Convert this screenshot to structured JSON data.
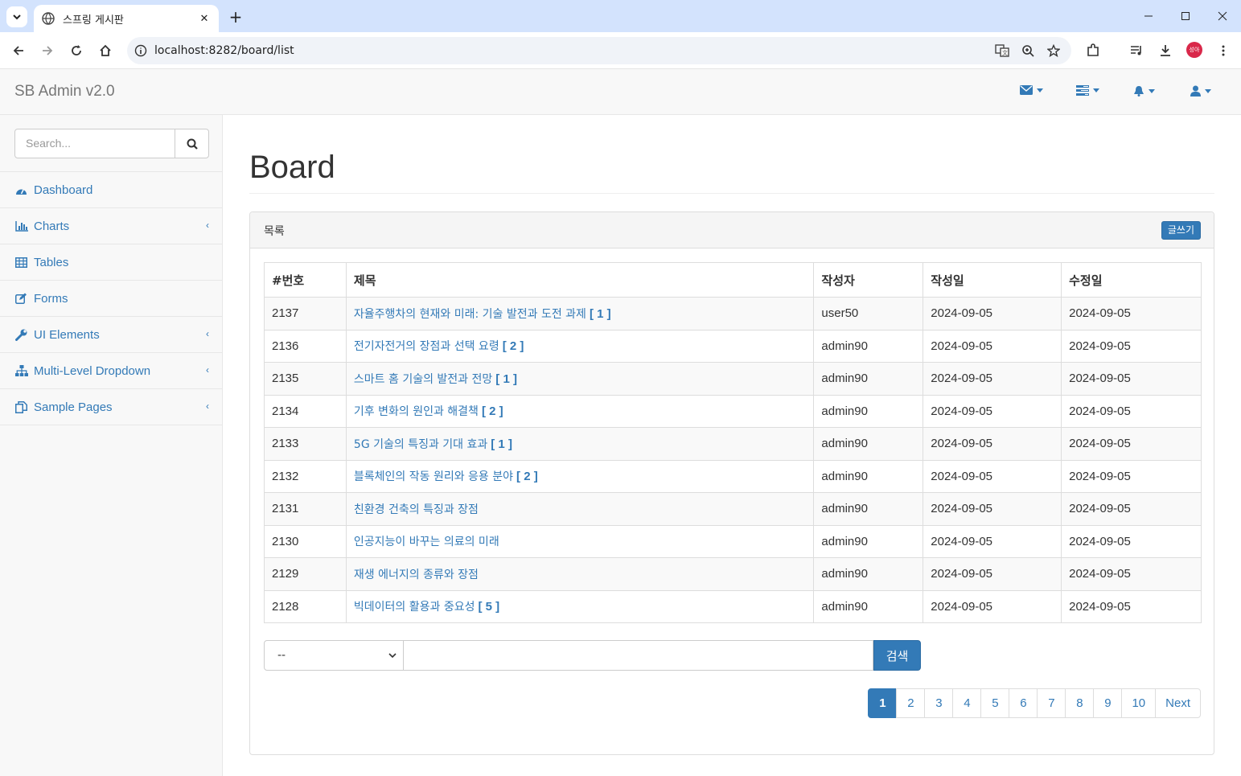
{
  "browser": {
    "tab_title": "스프링 게시판",
    "url": "localhost:8282/board/list",
    "profile_label": "성아"
  },
  "app": {
    "brand": "SB Admin v2.0",
    "search_placeholder": "Search...",
    "sidebar": [
      {
        "label": "Dashboard",
        "icon": "dashboard-icon",
        "submenu": false
      },
      {
        "label": "Charts",
        "icon": "bar-chart-icon",
        "submenu": true
      },
      {
        "label": "Tables",
        "icon": "table-icon",
        "submenu": false
      },
      {
        "label": "Forms",
        "icon": "edit-icon",
        "submenu": false
      },
      {
        "label": "UI Elements",
        "icon": "wrench-icon",
        "submenu": true
      },
      {
        "label": "Multi-Level Dropdown",
        "icon": "sitemap-icon",
        "submenu": true
      },
      {
        "label": "Sample Pages",
        "icon": "files-icon",
        "submenu": true
      }
    ]
  },
  "page": {
    "title": "Board",
    "panel_title": "목록",
    "write_button": "글쓰기",
    "columns": [
      "#번호",
      "제목",
      "작성자",
      "작성일",
      "수정일"
    ],
    "rows": [
      {
        "no": "2137",
        "title": "자율주행차의 현재와 미래: 기술 발전과 도전 과제",
        "replies": "[ 1 ]",
        "writer": "user50",
        "regdate": "2024-09-05",
        "updatedate": "2024-09-05"
      },
      {
        "no": "2136",
        "title": "전기자전거의 장점과 선택 요령",
        "replies": "[ 2 ]",
        "writer": "admin90",
        "regdate": "2024-09-05",
        "updatedate": "2024-09-05"
      },
      {
        "no": "2135",
        "title": "스마트 홈 기술의 발전과 전망",
        "replies": "[ 1 ]",
        "writer": "admin90",
        "regdate": "2024-09-05",
        "updatedate": "2024-09-05"
      },
      {
        "no": "2134",
        "title": "기후 변화의 원인과 해결책",
        "replies": "[ 2 ]",
        "writer": "admin90",
        "regdate": "2024-09-05",
        "updatedate": "2024-09-05"
      },
      {
        "no": "2133",
        "title": "5G 기술의 특징과 기대 효과",
        "replies": "[ 1 ]",
        "writer": "admin90",
        "regdate": "2024-09-05",
        "updatedate": "2024-09-05"
      },
      {
        "no": "2132",
        "title": "블록체인의 작동 원리와 응용 분야",
        "replies": "[ 2 ]",
        "writer": "admin90",
        "regdate": "2024-09-05",
        "updatedate": "2024-09-05"
      },
      {
        "no": "2131",
        "title": "친환경 건축의 특징과 장점",
        "replies": "",
        "writer": "admin90",
        "regdate": "2024-09-05",
        "updatedate": "2024-09-05"
      },
      {
        "no": "2130",
        "title": "인공지능이 바꾸는 의료의 미래",
        "replies": "",
        "writer": "admin90",
        "regdate": "2024-09-05",
        "updatedate": "2024-09-05"
      },
      {
        "no": "2129",
        "title": "재생 에너지의 종류와 장점",
        "replies": "",
        "writer": "admin90",
        "regdate": "2024-09-05",
        "updatedate": "2024-09-05"
      },
      {
        "no": "2128",
        "title": "빅데이터의 활용과 중요성",
        "replies": "[ 5 ]",
        "writer": "admin90",
        "regdate": "2024-09-05",
        "updatedate": "2024-09-05"
      }
    ],
    "search_type_selected": "--",
    "search_keyword": "",
    "search_button": "검색",
    "pages": [
      "1",
      "2",
      "3",
      "4",
      "5",
      "6",
      "7",
      "8",
      "9",
      "10"
    ],
    "current_page": "1",
    "next_label": "Next"
  },
  "colors": {
    "primary": "#337ab7",
    "tabbar": "#d3e3fd",
    "avatar": "#d9284a"
  }
}
